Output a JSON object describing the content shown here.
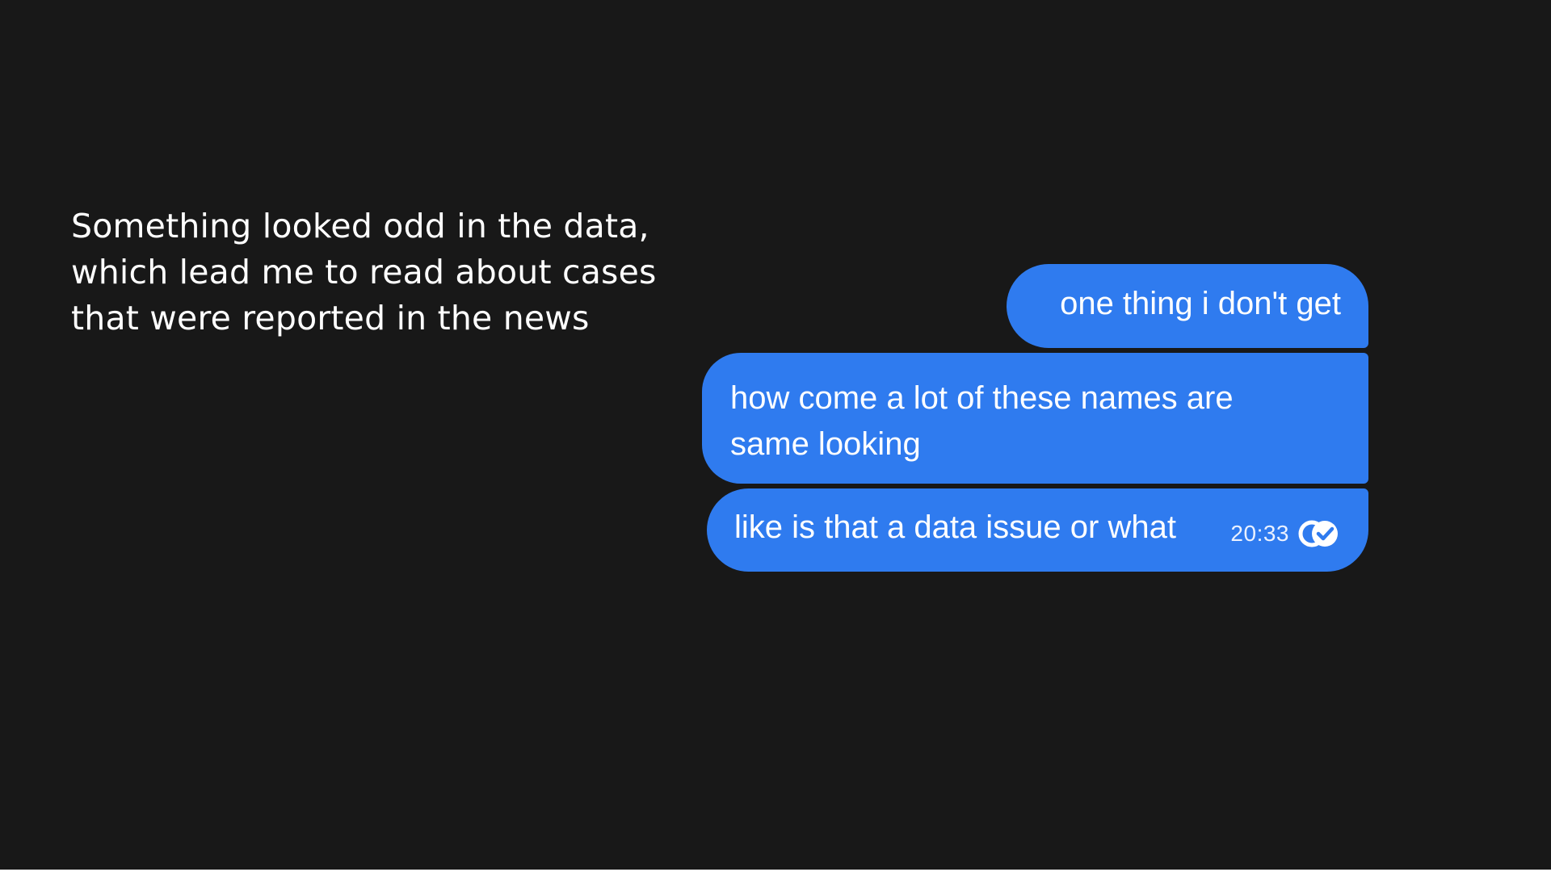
{
  "caption": {
    "lines": [
      "Something looked odd in the data,",
      "which lead me to read about cases",
      "that were reported in the news"
    ]
  },
  "chat": {
    "bubble_color": "#2f7bef",
    "messages": [
      {
        "lines": [
          "one thing i don't get"
        ]
      },
      {
        "lines": [
          "how come a lot of these names are",
          "same looking"
        ]
      },
      {
        "lines": [
          "like is that a data issue or what"
        ],
        "time": "20:33",
        "status_icon": "double-check-icon"
      }
    ]
  }
}
